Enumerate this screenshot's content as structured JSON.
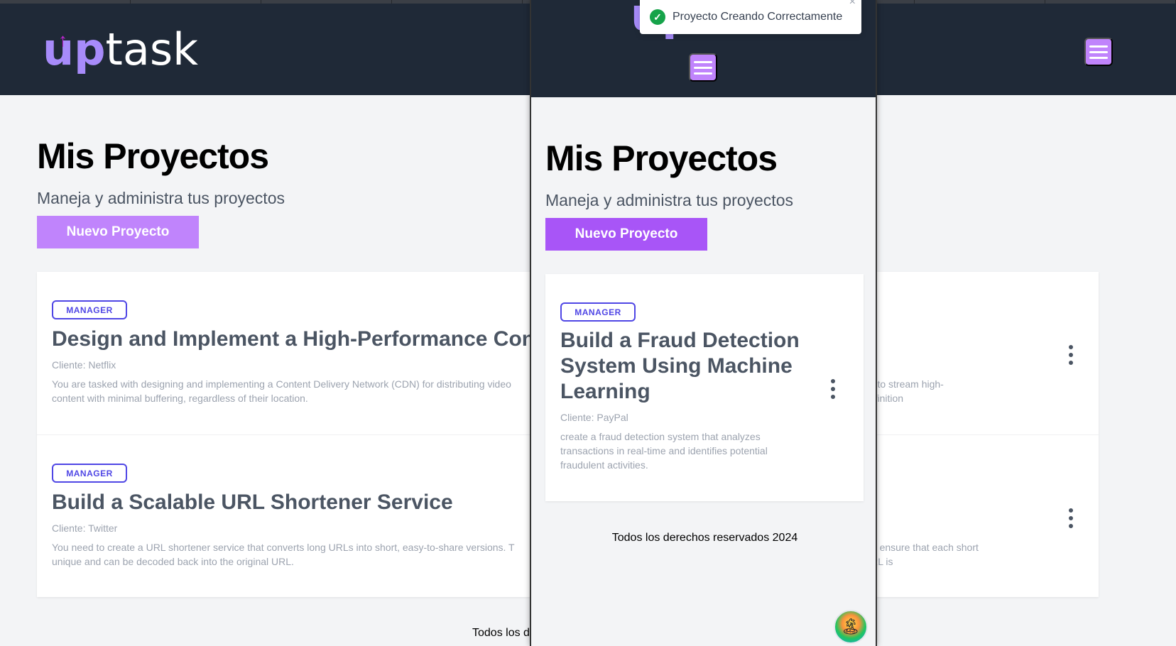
{
  "app": {
    "logo_up": "up",
    "logo_task": "task",
    "logo_arrow": "↑",
    "accent_color": "#c084fc",
    "header_color": "#1f2937",
    "badge_color": "#4f46e5"
  },
  "background_page": {
    "title": "Mis Proyectos",
    "subtitle": "Maneja y administra tus proyectos",
    "new_project_button": "Nuevo Proyecto",
    "projects": [
      {
        "role": "MANAGER",
        "title": "Design and Implement a High-Performance Cont",
        "client": "Cliente: Netflix",
        "description_left": "You are tasked with designing and implementing a Content Delivery Network (CDN) for distributing video",
        "description_left_line2": "content with minimal buffering, regardless of their location.",
        "description_right": "rld to stream high-definition"
      },
      {
        "role": "MANAGER",
        "title": "Build a Scalable URL Shortener Service",
        "client": "Cliente: Twitter",
        "description_left": "You need to create a URL shortener service that converts long URLs into short, easy-to-share versions. T",
        "description_left_line2": "unique and can be decoded back into the original URL.",
        "description_right": "ust ensure that each short URL is"
      }
    ],
    "footer": "Todos los d"
  },
  "mobile_page": {
    "title": "Mis Proyectos",
    "subtitle": "Maneja y administra tus proyectos",
    "new_project_button": "Nuevo Proyecto",
    "project": {
      "role": "MANAGER",
      "title": "Build a Fraud Detection System Using Machine Learning",
      "client": "Cliente: PayPal",
      "description": "create a fraud detection system that analyzes transactions in real-time and identifies potential fraudulent activities."
    },
    "footer": "Todos los derechos reservados 2024",
    "avatar_icon": "🏝"
  },
  "toast": {
    "message": "Proyecto Creando Correctamente",
    "icon": "check-circle-icon",
    "check_glyph": "✓",
    "close": "×"
  }
}
